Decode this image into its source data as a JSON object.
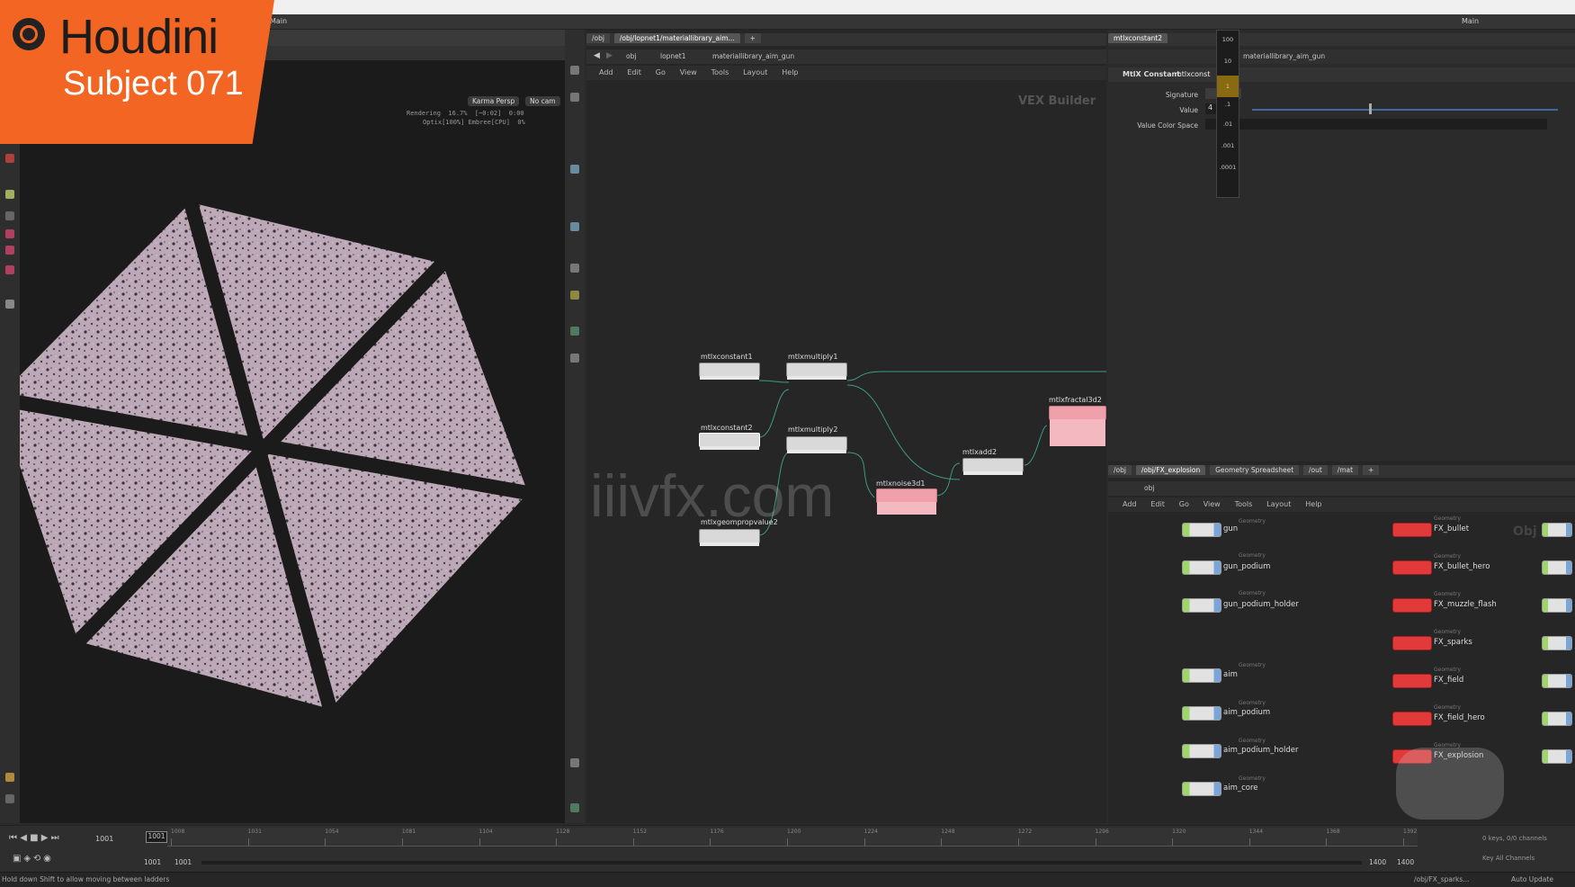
{
  "branding": {
    "title": "Houdini",
    "subtitle": "Subject 071",
    "logo_color": "#f26522"
  },
  "top_desktop": {
    "left_label": "Main",
    "right_label": "Main"
  },
  "viewport": {
    "camera_label": "Karma Persp",
    "cam_label": "No cam",
    "render_status_line1": "Rendering  16.7%  [~0:02]  0:00",
    "render_status_line2": "Optix[100%] Embree[CPU]  0%"
  },
  "network": {
    "tabs": [
      "/obj",
      "/obj/lopnet1/materiallibrary_aim...",
      "+"
    ],
    "path": [
      "obj",
      "lopnet1",
      "materiallibrary_aim_gun"
    ],
    "menu": [
      "Add",
      "Edit",
      "Go",
      "View",
      "Tools",
      "Layout",
      "Help"
    ],
    "context_label": "VEX Builder",
    "nodes": [
      {
        "name": "mtlxconstant1",
        "color": "gray"
      },
      {
        "name": "mtlxmultiply1",
        "color": "gray"
      },
      {
        "name": "mtlxconstant2",
        "color": "gray"
      },
      {
        "name": "mtlxmultiply2",
        "color": "gray"
      },
      {
        "name": "mtlxfractal3d2",
        "color": "pink"
      },
      {
        "name": "mtlxadd2",
        "color": "gray"
      },
      {
        "name": "mtlxnoise3d1",
        "color": "pink"
      },
      {
        "name": "mtlxgeompropvalue2",
        "color": "gray"
      }
    ],
    "watermark": "iiivfx.com"
  },
  "parameters": {
    "tab": "mtlxconstant2",
    "path_tab": "materiallibrary_aim_gun",
    "node_type": "MtlX Constant",
    "node_name": "mtlxconst",
    "rows": [
      {
        "label": "Signature",
        "value": ""
      },
      {
        "label": "Value",
        "value": "4"
      },
      {
        "label": "Value Color Space",
        "value": ""
      }
    ],
    "ladder": [
      "100",
      "10",
      "1",
      ".1",
      ".01",
      ".001",
      ".0001"
    ]
  },
  "obj_network": {
    "tabs": [
      "/obj",
      "/obj/FX_explosion",
      "Geometry Spreadsheet",
      "/out",
      "/mat",
      "+"
    ],
    "path": "obj",
    "menu": [
      "Add",
      "Edit",
      "Go",
      "View",
      "Tools",
      "Layout",
      "Help"
    ],
    "context_label": "Obj",
    "left_nodes": [
      "gun",
      "gun_podium",
      "gun_podium_holder",
      "aim",
      "aim_podium",
      "aim_podium_holder",
      "aim_core"
    ],
    "right_nodes": [
      "FX_bullet",
      "FX_bullet_hero",
      "FX_muzzle_flash",
      "FX_sparks",
      "FX_field",
      "FX_field_hero",
      "FX_explosion"
    ],
    "node_type_label": "Geometry"
  },
  "timeline": {
    "current_frame": "1001",
    "frame_field": "1001",
    "start": "1001",
    "start2": "1001",
    "end": "1400",
    "end2": "1400",
    "ticks": [
      "1008",
      "1031",
      "1054",
      "1081",
      "1104",
      "1128",
      "1152",
      "1176",
      "1200",
      "1224",
      "1248",
      "1272",
      "1296",
      "1320",
      "1344",
      "1368",
      "1392"
    ],
    "channels_label": "0 keys, 0/0 channels",
    "key_all_label": "Key All Channels"
  },
  "status": {
    "message": "Hold down Shift to allow moving between ladders",
    "path": "/obj/FX_sparks...",
    "update_mode": "Auto Update"
  },
  "colors": {
    "accent_orange": "#f26522",
    "node_pink": "#f0a0aa",
    "node_red": "#e23a3a",
    "node_green": "#9ed66a"
  }
}
